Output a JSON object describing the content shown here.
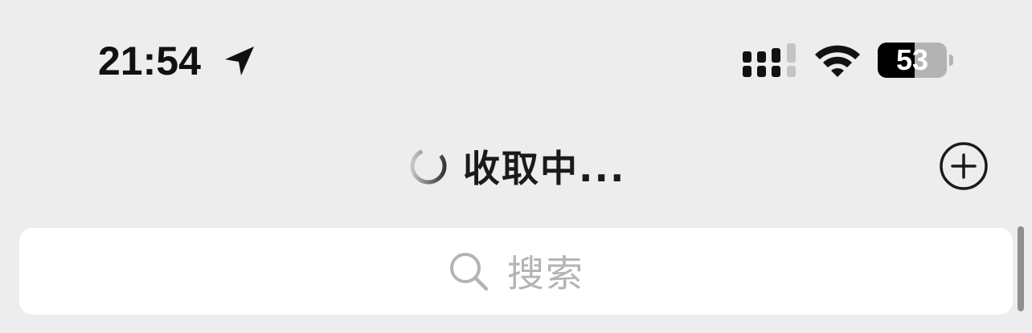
{
  "status_bar": {
    "time": "21:54",
    "battery_percent": "53",
    "battery_level": 53,
    "location_icon": "location-arrow-icon",
    "signal_icon": "cellular-signal-icon",
    "wifi_icon": "wifi-icon"
  },
  "nav": {
    "title": "收取中...",
    "spinner_icon": "loading-spinner-icon",
    "add_icon": "plus-circle-icon"
  },
  "search": {
    "placeholder": "搜索",
    "icon": "search-icon"
  },
  "colors": {
    "background": "#ededed",
    "search_background": "#ffffff",
    "placeholder": "#b4b4b4"
  }
}
